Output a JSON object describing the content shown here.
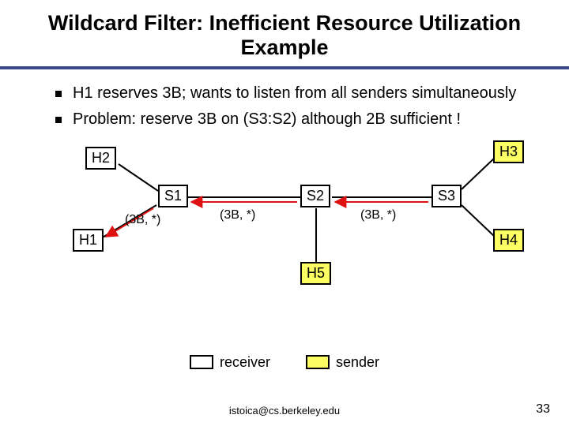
{
  "title": "Wildcard Filter: Inefficient Resource Utilization Example",
  "bullets": [
    "H1 reserves 3B; wants to listen from all senders simultaneously",
    " Problem: reserve 3B on (S3:S2) although 2B sufficient !"
  ],
  "nodes": {
    "h1": "H1",
    "h2": "H2",
    "h3": "H3",
    "h4": "H4",
    "h5": "H5",
    "s1": "S1",
    "s2": "S2",
    "s3": "S3"
  },
  "edgeLabels": {
    "s1h1": "(3B, *)",
    "s1s2": "(3B, *)",
    "s2s3": "(3B, *)"
  },
  "legend": {
    "receiver": "receiver",
    "sender": "sender"
  },
  "footer": "istoica@cs.berkeley.edu",
  "page": "33"
}
